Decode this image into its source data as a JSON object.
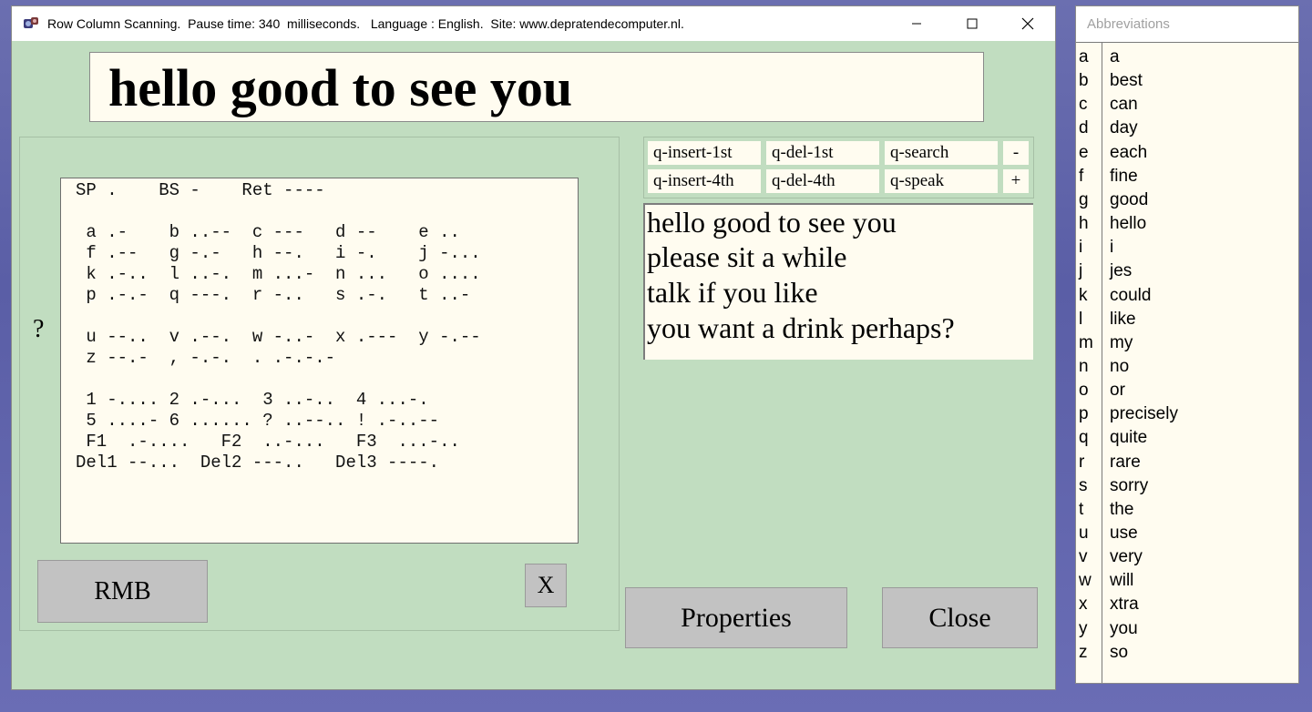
{
  "window": {
    "title": "Row Column Scanning.  Pause time: 340  milliseconds.   Language : English.  Site: www.depratendecomputer.nl."
  },
  "output_text": "hello good to see you",
  "morse_help": {
    "question_mark": "?",
    "lines": [
      "SP .    BS -    Ret ----",
      "",
      " a .-    b ..--  c ---   d --    e ..",
      " f .--   g -.-   h --.   i -.    j -...",
      " k .-..  l ..-.  m ...-  n ...   o ....",
      " p .-.-  q ---.  r -..   s .-.   t ..-",
      "",
      " u --..  v .--.  w -..-  x .---  y -.--",
      " z --.-  , -.-.  . .-.-.-",
      "",
      " 1 -.... 2 .-...  3 ..-..  4 ...-.",
      " 5 ....- 6 ...... ? ..--.. ! .-..--",
      " F1  .-....   F2  ..-...   F3  ...-..",
      "Del1 --...  Del2 ---..   Del3 ----."
    ]
  },
  "buttons": {
    "rmb": "RMB",
    "x": "X",
    "properties": "Properties",
    "close": "Close"
  },
  "quick_actions": [
    [
      "q-insert-1st",
      "q-del-1st",
      "q-search",
      "-"
    ],
    [
      "q-insert-4th",
      "q-del-4th",
      "q-speak",
      "+"
    ]
  ],
  "phrases": [
    "hello good to see you",
    "please sit a while",
    "talk if you like",
    "you want a drink perhaps?"
  ],
  "abbreviations": {
    "title": "Abbreviations",
    "entries": [
      {
        "key": "a",
        "value": "a"
      },
      {
        "key": "b",
        "value": "best"
      },
      {
        "key": "c",
        "value": "can"
      },
      {
        "key": "d",
        "value": "day"
      },
      {
        "key": "e",
        "value": "each"
      },
      {
        "key": "f",
        "value": "fine"
      },
      {
        "key": "g",
        "value": "good"
      },
      {
        "key": "h",
        "value": "hello"
      },
      {
        "key": "i",
        "value": "i"
      },
      {
        "key": "j",
        "value": "jes"
      },
      {
        "key": "k",
        "value": "could"
      },
      {
        "key": "l",
        "value": "like"
      },
      {
        "key": "m",
        "value": "my"
      },
      {
        "key": "n",
        "value": "no"
      },
      {
        "key": "o",
        "value": "or"
      },
      {
        "key": "p",
        "value": "precisely"
      },
      {
        "key": "q",
        "value": "quite"
      },
      {
        "key": "r",
        "value": "rare"
      },
      {
        "key": "s",
        "value": "sorry"
      },
      {
        "key": "t",
        "value": "the"
      },
      {
        "key": "u",
        "value": "use"
      },
      {
        "key": "v",
        "value": "very"
      },
      {
        "key": "w",
        "value": "will"
      },
      {
        "key": "x",
        "value": "xtra"
      },
      {
        "key": "y",
        "value": "you"
      },
      {
        "key": "z",
        "value": "so"
      }
    ]
  },
  "colors": {
    "window_bg": "#c1ddc0",
    "field_bg": "#fffcf0",
    "button_bg": "#c2c2c2"
  }
}
